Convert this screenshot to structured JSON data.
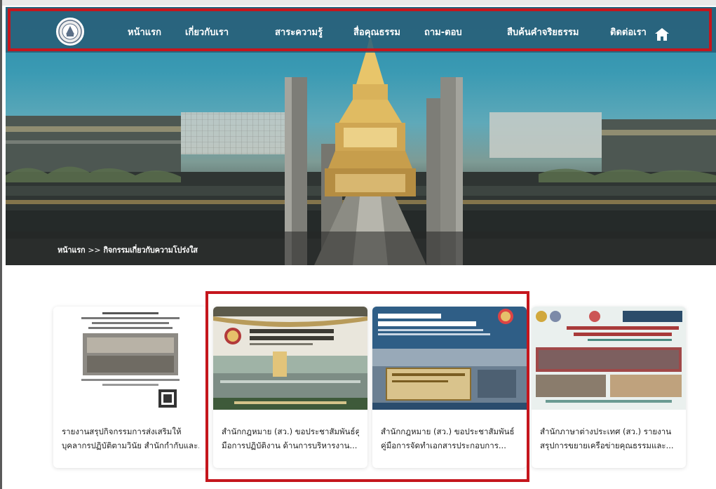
{
  "header": {
    "nav": [
      {
        "label": "หน้าแรก"
      },
      {
        "label": "เกี่ยวกับเรา"
      },
      {
        "label": "สาระความรู้"
      },
      {
        "label": "สื่อคุณธรรม"
      },
      {
        "label": "ถาม-ตอบ"
      },
      {
        "label": "สืบค้นคำจริยธรรม"
      },
      {
        "label": "ติดต่อเรา"
      }
    ],
    "logo_icon": "seal-logo-icon",
    "home_icon": "home-icon"
  },
  "breadcrumb": {
    "home": "หน้าแรก",
    "separator": ">>",
    "current": "กิจกรรมเกี่ยวกับความโปร่งใส"
  },
  "cards": [
    {
      "line1": "รายงานสรุปกิจกรรมการส่งเสริมให้",
      "line2": "บุคลากรปฏิบัติตามวินัย สำนักกำกับและ..."
    },
    {
      "line1": "สำนักกฎหมาย (สว.) ขอประชาสัมพันธ์คู่",
      "line2": "มือการปฏิบัติงาน ด้านการบริหารงาน..."
    },
    {
      "line1": "สำนักกฎหมาย (สว.) ขอประชาสัมพันธ์",
      "line2": "คู่มือการจัดทำเอกสารประกอบการ..."
    },
    {
      "line1": "สำนักภาษาต่างประเทศ (สว.) รายงาน",
      "line2": "สรุปการขยายเครือข่ายคุณธรรมและ..."
    }
  ],
  "highlight_color": "#c5161d",
  "nav_bg_color": "#285f78"
}
